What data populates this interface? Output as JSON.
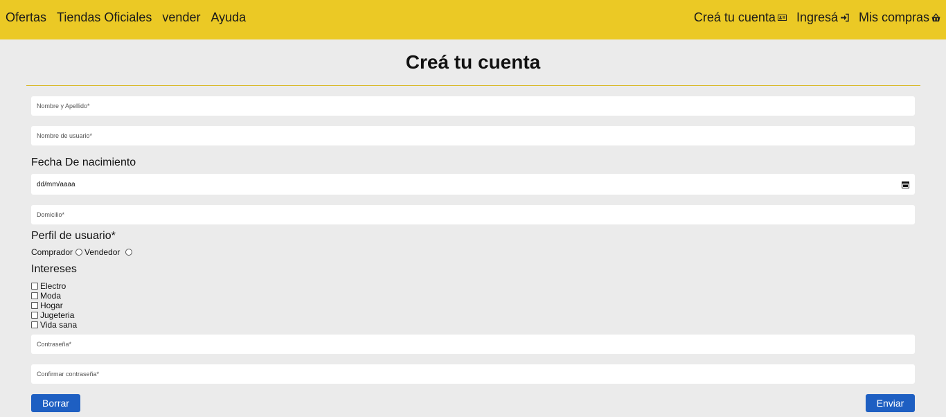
{
  "nav": {
    "left": [
      "Ofertas",
      "Tiendas Oficiales",
      "vender",
      "Ayuda"
    ],
    "right": [
      {
        "label": "Creá tu cuenta",
        "icon": "id-card-icon"
      },
      {
        "label": "Ingresá",
        "icon": "sign-in-icon"
      },
      {
        "label": "Mis compras",
        "icon": "basket-icon"
      }
    ]
  },
  "form": {
    "title": "Creá tu cuenta",
    "name_placeholder": "Nombre y Apellido*",
    "username_placeholder": "Nombre de usuario*",
    "birth_label": "Fecha De nacimiento",
    "birth_value": "dd/mm/aaaa",
    "address_placeholder": "Domicilio*",
    "profile_label": "Perfil de usuario*",
    "profile_options": [
      "Comprador",
      "Vendedor"
    ],
    "interests_label": "Intereses",
    "interests": [
      "Electro",
      "Moda",
      "Hogar",
      "Jugeteria",
      "Vida sana"
    ],
    "password_placeholder": "Contraseña*",
    "confirm_placeholder": "Confirmar contraseña*",
    "reset_label": "Borrar",
    "submit_label": "Enviar"
  },
  "colors": {
    "header": "#ebc925",
    "background": "#ebebeb",
    "button": "#1e5fc2"
  }
}
